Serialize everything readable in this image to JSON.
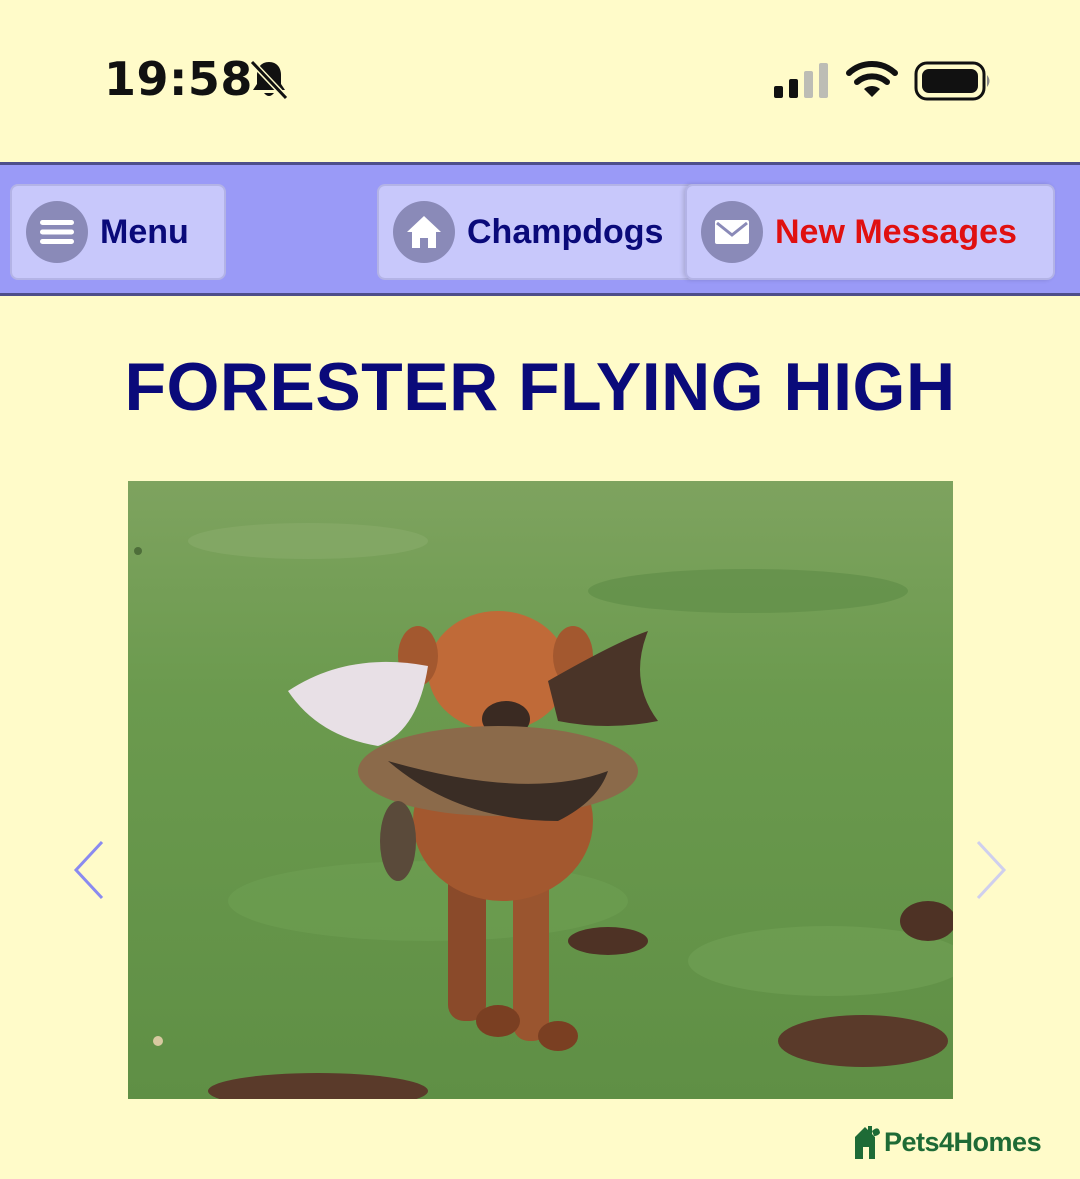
{
  "status_bar": {
    "time": "19:58",
    "icons": [
      "bell-slash-icon",
      "signal-icon",
      "wifi-icon",
      "battery-icon"
    ]
  },
  "nav": {
    "menu_label": "Menu",
    "home_label": "Champdogs",
    "messages_label": "New Messages",
    "icons": [
      "hamburger-icon",
      "home-icon",
      "envelope-icon"
    ]
  },
  "page": {
    "title": "FORESTER FLYING HIGH"
  },
  "gallery": {
    "prev_icon": "chevron-left-icon",
    "next_icon": "chevron-right-icon"
  },
  "watermark": {
    "text": "Pets4Homes"
  },
  "colors": {
    "background": "#fffbc9",
    "nav_background": "#9a9af7",
    "nav_button": "#c8c8fb",
    "title": "#0a0a7a",
    "alert_text": "#e01010",
    "logo_green": "#1e6b36"
  }
}
